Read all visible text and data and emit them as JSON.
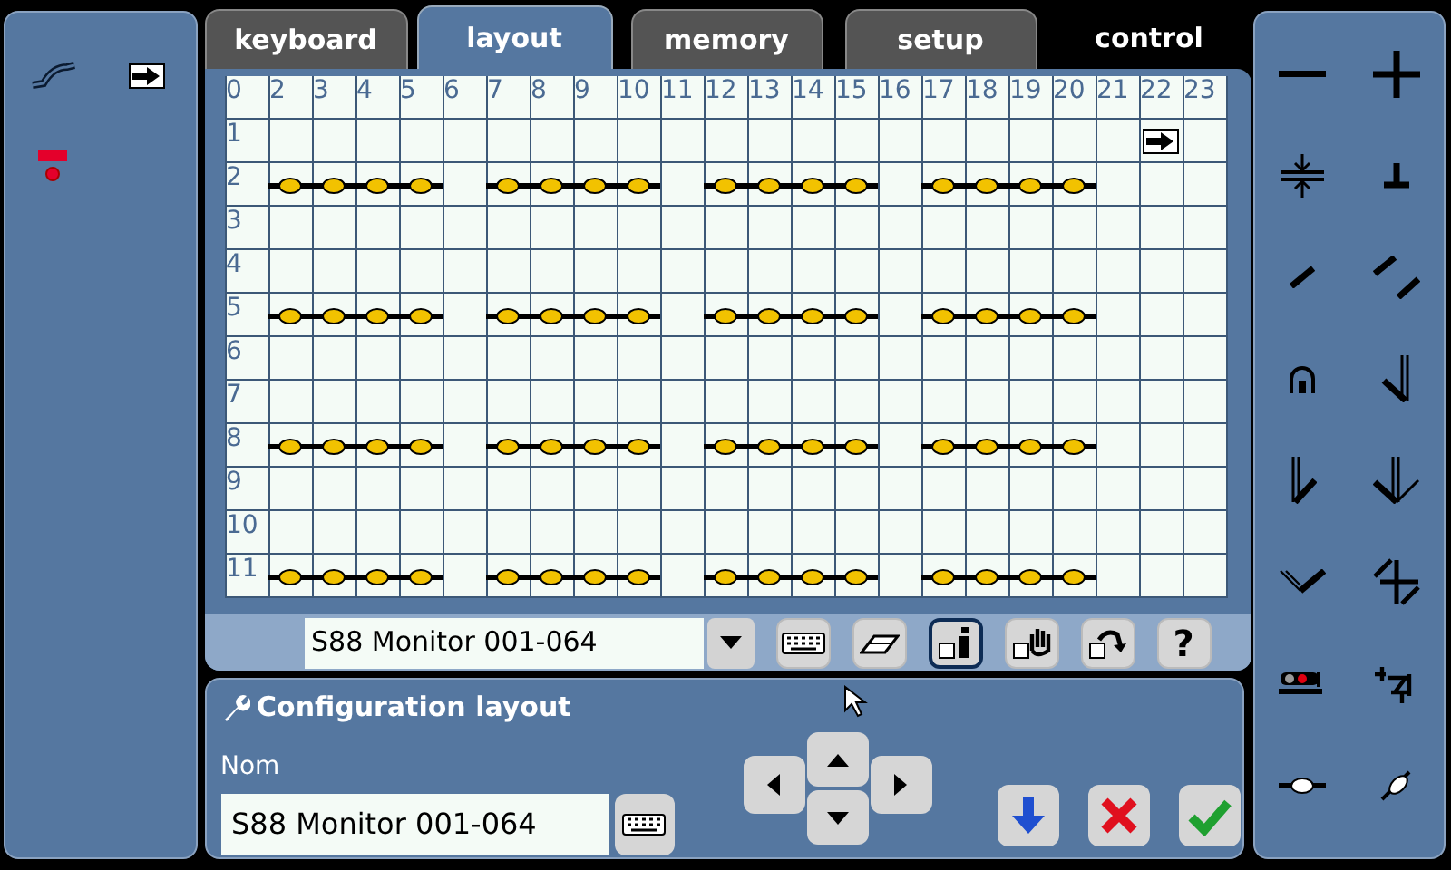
{
  "tabs": [
    {
      "label": "keyboard",
      "kind": "tab",
      "selected": false
    },
    {
      "label": "layout",
      "kind": "tab",
      "selected": true
    },
    {
      "label": "memory",
      "kind": "tab",
      "selected": false
    },
    {
      "label": "setup",
      "kind": "tab",
      "selected": false
    },
    {
      "label": "control",
      "kind": "plain",
      "selected": false
    }
  ],
  "grid": {
    "corner": "0",
    "column_labels": [
      "2",
      "3",
      "4",
      "5",
      "6",
      "7",
      "8",
      "9",
      "10",
      "11",
      "12",
      "13",
      "14",
      "15",
      "16",
      "17",
      "18",
      "19",
      "20",
      "21",
      "22",
      "23"
    ],
    "rows": [
      {
        "label": "1",
        "cells": [
          {
            "kind": "empty"
          },
          {
            "kind": "empty"
          },
          {
            "kind": "empty"
          },
          {
            "kind": "empty"
          },
          {
            "kind": "empty"
          },
          {
            "kind": "empty"
          },
          {
            "kind": "empty"
          },
          {
            "kind": "empty"
          },
          {
            "kind": "empty"
          },
          {
            "kind": "empty"
          },
          {
            "kind": "empty"
          },
          {
            "kind": "empty"
          },
          {
            "kind": "empty"
          },
          {
            "kind": "empty"
          },
          {
            "kind": "empty"
          },
          {
            "kind": "empty"
          },
          {
            "kind": "empty"
          },
          {
            "kind": "empty"
          },
          {
            "kind": "empty"
          },
          {
            "kind": "empty"
          },
          {
            "kind": "arrow"
          },
          {
            "kind": "empty"
          }
        ]
      },
      {
        "label": "2",
        "cells": [
          {
            "kind": "contact"
          },
          {
            "kind": "contact"
          },
          {
            "kind": "contact"
          },
          {
            "kind": "contact"
          },
          {
            "kind": "empty"
          },
          {
            "kind": "contact"
          },
          {
            "kind": "contact"
          },
          {
            "kind": "contact"
          },
          {
            "kind": "contact"
          },
          {
            "kind": "empty"
          },
          {
            "kind": "contact"
          },
          {
            "kind": "contact"
          },
          {
            "kind": "contact"
          },
          {
            "kind": "contact"
          },
          {
            "kind": "empty"
          },
          {
            "kind": "contact"
          },
          {
            "kind": "contact"
          },
          {
            "kind": "contact"
          },
          {
            "kind": "contact"
          },
          {
            "kind": "empty"
          },
          {
            "kind": "empty"
          },
          {
            "kind": "empty"
          }
        ]
      },
      {
        "label": "3",
        "cells": [
          {
            "kind": "empty"
          },
          {
            "kind": "empty"
          },
          {
            "kind": "empty"
          },
          {
            "kind": "empty"
          },
          {
            "kind": "empty"
          },
          {
            "kind": "empty"
          },
          {
            "kind": "empty"
          },
          {
            "kind": "empty"
          },
          {
            "kind": "empty"
          },
          {
            "kind": "empty"
          },
          {
            "kind": "empty"
          },
          {
            "kind": "empty"
          },
          {
            "kind": "empty"
          },
          {
            "kind": "empty"
          },
          {
            "kind": "empty"
          },
          {
            "kind": "empty"
          },
          {
            "kind": "empty"
          },
          {
            "kind": "empty"
          },
          {
            "kind": "empty"
          },
          {
            "kind": "empty"
          },
          {
            "kind": "empty"
          },
          {
            "kind": "empty"
          }
        ]
      },
      {
        "label": "4",
        "cells": [
          {
            "kind": "empty"
          },
          {
            "kind": "empty"
          },
          {
            "kind": "empty"
          },
          {
            "kind": "empty"
          },
          {
            "kind": "empty"
          },
          {
            "kind": "empty"
          },
          {
            "kind": "empty"
          },
          {
            "kind": "empty"
          },
          {
            "kind": "empty"
          },
          {
            "kind": "empty"
          },
          {
            "kind": "empty"
          },
          {
            "kind": "empty"
          },
          {
            "kind": "empty"
          },
          {
            "kind": "empty"
          },
          {
            "kind": "empty"
          },
          {
            "kind": "empty"
          },
          {
            "kind": "empty"
          },
          {
            "kind": "empty"
          },
          {
            "kind": "empty"
          },
          {
            "kind": "empty"
          },
          {
            "kind": "empty"
          },
          {
            "kind": "empty"
          }
        ]
      },
      {
        "label": "5",
        "cells": [
          {
            "kind": "contact"
          },
          {
            "kind": "contact"
          },
          {
            "kind": "contact"
          },
          {
            "kind": "contact"
          },
          {
            "kind": "empty"
          },
          {
            "kind": "contact"
          },
          {
            "kind": "contact"
          },
          {
            "kind": "contact"
          },
          {
            "kind": "contact"
          },
          {
            "kind": "empty"
          },
          {
            "kind": "contact"
          },
          {
            "kind": "contact"
          },
          {
            "kind": "contact"
          },
          {
            "kind": "contact"
          },
          {
            "kind": "empty"
          },
          {
            "kind": "contact"
          },
          {
            "kind": "contact"
          },
          {
            "kind": "contact"
          },
          {
            "kind": "contact"
          },
          {
            "kind": "empty"
          },
          {
            "kind": "empty"
          },
          {
            "kind": "empty"
          }
        ]
      },
      {
        "label": "6",
        "cells": [
          {
            "kind": "empty"
          },
          {
            "kind": "empty"
          },
          {
            "kind": "empty"
          },
          {
            "kind": "empty"
          },
          {
            "kind": "empty"
          },
          {
            "kind": "empty"
          },
          {
            "kind": "empty"
          },
          {
            "kind": "empty"
          },
          {
            "kind": "empty"
          },
          {
            "kind": "empty"
          },
          {
            "kind": "empty"
          },
          {
            "kind": "empty"
          },
          {
            "kind": "empty"
          },
          {
            "kind": "empty"
          },
          {
            "kind": "empty"
          },
          {
            "kind": "empty"
          },
          {
            "kind": "empty"
          },
          {
            "kind": "empty"
          },
          {
            "kind": "empty"
          },
          {
            "kind": "empty"
          },
          {
            "kind": "empty"
          },
          {
            "kind": "empty"
          }
        ]
      },
      {
        "label": "7",
        "cells": [
          {
            "kind": "empty"
          },
          {
            "kind": "empty"
          },
          {
            "kind": "empty"
          },
          {
            "kind": "empty"
          },
          {
            "kind": "empty"
          },
          {
            "kind": "empty"
          },
          {
            "kind": "empty"
          },
          {
            "kind": "empty"
          },
          {
            "kind": "empty"
          },
          {
            "kind": "empty"
          },
          {
            "kind": "empty"
          },
          {
            "kind": "empty"
          },
          {
            "kind": "empty"
          },
          {
            "kind": "empty"
          },
          {
            "kind": "empty"
          },
          {
            "kind": "empty"
          },
          {
            "kind": "empty"
          },
          {
            "kind": "empty"
          },
          {
            "kind": "empty"
          },
          {
            "kind": "empty"
          },
          {
            "kind": "empty"
          },
          {
            "kind": "empty"
          }
        ]
      },
      {
        "label": "8",
        "cells": [
          {
            "kind": "contact"
          },
          {
            "kind": "contact"
          },
          {
            "kind": "contact"
          },
          {
            "kind": "contact"
          },
          {
            "kind": "empty"
          },
          {
            "kind": "contact"
          },
          {
            "kind": "contact"
          },
          {
            "kind": "contact"
          },
          {
            "kind": "contact"
          },
          {
            "kind": "empty"
          },
          {
            "kind": "contact"
          },
          {
            "kind": "contact"
          },
          {
            "kind": "contact"
          },
          {
            "kind": "contact"
          },
          {
            "kind": "empty"
          },
          {
            "kind": "contact"
          },
          {
            "kind": "contact"
          },
          {
            "kind": "contact"
          },
          {
            "kind": "contact"
          },
          {
            "kind": "empty"
          },
          {
            "kind": "empty"
          },
          {
            "kind": "empty"
          }
        ]
      },
      {
        "label": "9",
        "cells": [
          {
            "kind": "empty"
          },
          {
            "kind": "empty"
          },
          {
            "kind": "empty"
          },
          {
            "kind": "empty"
          },
          {
            "kind": "empty"
          },
          {
            "kind": "empty"
          },
          {
            "kind": "empty"
          },
          {
            "kind": "empty"
          },
          {
            "kind": "empty"
          },
          {
            "kind": "empty"
          },
          {
            "kind": "empty"
          },
          {
            "kind": "empty"
          },
          {
            "kind": "empty"
          },
          {
            "kind": "empty"
          },
          {
            "kind": "empty"
          },
          {
            "kind": "empty"
          },
          {
            "kind": "empty"
          },
          {
            "kind": "empty"
          },
          {
            "kind": "empty"
          },
          {
            "kind": "empty"
          },
          {
            "kind": "empty"
          },
          {
            "kind": "empty"
          }
        ]
      },
      {
        "label": "10",
        "cells": [
          {
            "kind": "empty"
          },
          {
            "kind": "empty"
          },
          {
            "kind": "empty"
          },
          {
            "kind": "empty"
          },
          {
            "kind": "empty"
          },
          {
            "kind": "empty"
          },
          {
            "kind": "empty"
          },
          {
            "kind": "empty"
          },
          {
            "kind": "empty"
          },
          {
            "kind": "empty"
          },
          {
            "kind": "empty"
          },
          {
            "kind": "empty"
          },
          {
            "kind": "empty"
          },
          {
            "kind": "empty"
          },
          {
            "kind": "empty"
          },
          {
            "kind": "empty"
          },
          {
            "kind": "empty"
          },
          {
            "kind": "empty"
          },
          {
            "kind": "empty"
          },
          {
            "kind": "empty"
          },
          {
            "kind": "empty"
          },
          {
            "kind": "empty"
          }
        ]
      },
      {
        "label": "11",
        "cells": [
          {
            "kind": "contact"
          },
          {
            "kind": "contact"
          },
          {
            "kind": "contact"
          },
          {
            "kind": "contact"
          },
          {
            "kind": "empty"
          },
          {
            "kind": "contact"
          },
          {
            "kind": "contact"
          },
          {
            "kind": "contact"
          },
          {
            "kind": "contact"
          },
          {
            "kind": "empty"
          },
          {
            "kind": "contact"
          },
          {
            "kind": "contact"
          },
          {
            "kind": "contact"
          },
          {
            "kind": "contact"
          },
          {
            "kind": "empty"
          },
          {
            "kind": "contact"
          },
          {
            "kind": "contact"
          },
          {
            "kind": "contact"
          },
          {
            "kind": "contact"
          },
          {
            "kind": "empty"
          },
          {
            "kind": "empty"
          },
          {
            "kind": "empty"
          }
        ]
      }
    ]
  },
  "toolbar": {
    "monitor_select": {
      "value": "S88 Monitor 001-064"
    },
    "tools": [
      {
        "kind": "keyboard",
        "selected": false
      },
      {
        "kind": "eraser",
        "selected": false
      },
      {
        "kind": "info",
        "selected": true
      },
      {
        "kind": "hand",
        "selected": false
      },
      {
        "kind": "rotate",
        "selected": false
      },
      {
        "kind": "help",
        "label": "?",
        "selected": false
      }
    ]
  },
  "config": {
    "title": "Configuration layout",
    "name_label": "Nom",
    "name_value": "S88 Monitor 001-064"
  }
}
